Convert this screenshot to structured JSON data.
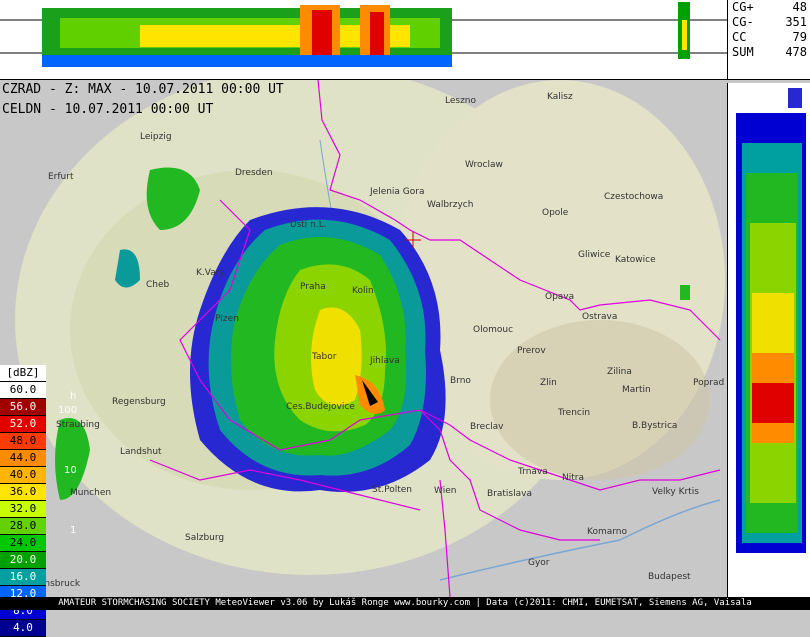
{
  "header": {
    "line1": "CZRAD - Z: MAX - 10.07.2011 00:00 UT",
    "line2": "CELDN - 10.07.2011 00:00 UT"
  },
  "stats": [
    {
      "label": "CG+",
      "value": "48"
    },
    {
      "label": "CG-",
      "value": "351"
    },
    {
      "label": "CC",
      "value": "79"
    },
    {
      "label": "SUM",
      "value": "478"
    }
  ],
  "legend": {
    "unit": "[dBZ]",
    "levels": [
      {
        "label": "60.0",
        "color": "#ffffff"
      },
      {
        "label": "56.0",
        "color": "#a00000"
      },
      {
        "label": "52.0",
        "color": "#e00000"
      },
      {
        "label": "48.0",
        "color": "#ff3c00"
      },
      {
        "label": "44.0",
        "color": "#ff8c00"
      },
      {
        "label": "40.0",
        "color": "#ffb400"
      },
      {
        "label": "36.0",
        "color": "#ffe400"
      },
      {
        "label": "32.0",
        "color": "#c8ff00"
      },
      {
        "label": "28.0",
        "color": "#64d200"
      },
      {
        "label": "24.0",
        "color": "#00c800"
      },
      {
        "label": "20.0",
        "color": "#00a000"
      },
      {
        "label": "16.0",
        "color": "#00a0a0"
      },
      {
        "label": "12.0",
        "color": "#0064ff"
      },
      {
        "label": "8.0",
        "color": "#0000d2"
      },
      {
        "label": "4.0",
        "color": "#000090"
      }
    ],
    "h_label": "h",
    "h_ticks": [
      "100",
      "10",
      "1"
    ]
  },
  "cities": [
    {
      "name": "Leszno"
    },
    {
      "name": "Kalisz"
    },
    {
      "name": "Leipzig"
    },
    {
      "name": "Wroclaw"
    },
    {
      "name": "Dresden"
    },
    {
      "name": "Jelenia Gora"
    },
    {
      "name": "Erfurt"
    },
    {
      "name": "Walbrzych"
    },
    {
      "name": "Czestochowa"
    },
    {
      "name": "Opole"
    },
    {
      "name": "Usti n.L."
    },
    {
      "name": "Gliwice"
    },
    {
      "name": "Katowice"
    },
    {
      "name": "K.Vary"
    },
    {
      "name": "Cheb"
    },
    {
      "name": "Praha"
    },
    {
      "name": "Kolin"
    },
    {
      "name": "Opava"
    },
    {
      "name": "Ostrava"
    },
    {
      "name": "Plzen"
    },
    {
      "name": "Olomouc"
    },
    {
      "name": "Tabor"
    },
    {
      "name": "Prerov"
    },
    {
      "name": "Jihlava"
    },
    {
      "name": "Zilina"
    },
    {
      "name": "Martin"
    },
    {
      "name": "Brno"
    },
    {
      "name": "Zlin"
    },
    {
      "name": "Poprad"
    },
    {
      "name": "Regensburg"
    },
    {
      "name": "Ces.Budejovice"
    },
    {
      "name": "Trencin"
    },
    {
      "name": "Straubing"
    },
    {
      "name": "B.Bystrica"
    },
    {
      "name": "Breclav"
    },
    {
      "name": "Landshut"
    },
    {
      "name": "Trnava"
    },
    {
      "name": "Nitra"
    },
    {
      "name": "Munchen"
    },
    {
      "name": "St.Polten"
    },
    {
      "name": "Wien"
    },
    {
      "name": "Bratislava"
    },
    {
      "name": "Velky Krtis"
    },
    {
      "name": "Salzburg"
    },
    {
      "name": "Komarno"
    },
    {
      "name": "Gyor"
    },
    {
      "name": "Innsbruck"
    },
    {
      "name": "Budapest"
    }
  ],
  "footer": "AMATEUR STORMCHASING SOCIETY MeteoViewer v3.06 by Lukáš Ronge www.bourky.com | Data (c)2011: CHMI, EUMETSAT, Siemens AG, Vaisala"
}
